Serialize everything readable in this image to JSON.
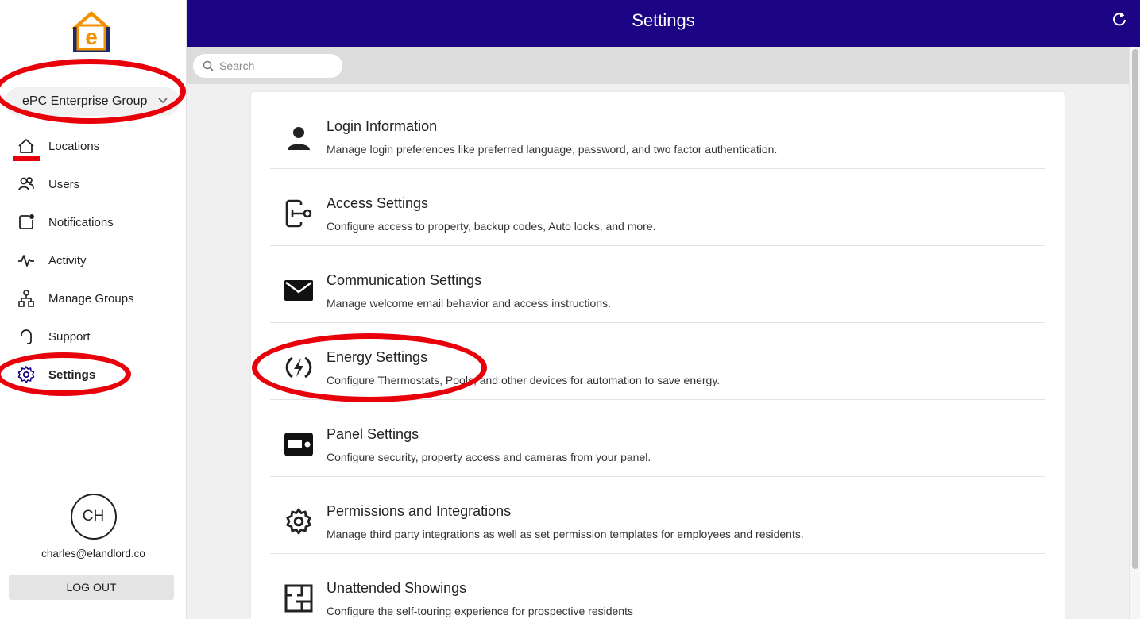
{
  "header": {
    "title": "Settings"
  },
  "org": {
    "name": "ePC Enterprise Group"
  },
  "logo": {
    "letter": "e"
  },
  "sidebar": {
    "items": [
      {
        "label": "Locations",
        "icon": "home-icon"
      },
      {
        "label": "Users",
        "icon": "users-icon"
      },
      {
        "label": "Notifications",
        "icon": "notification-icon"
      },
      {
        "label": "Activity",
        "icon": "activity-icon"
      },
      {
        "label": "Manage Groups",
        "icon": "groups-icon"
      },
      {
        "label": "Support",
        "icon": "support-icon"
      },
      {
        "label": "Settings",
        "icon": "gear-icon",
        "active": true
      }
    ]
  },
  "profile": {
    "initials": "CH",
    "email": "charles@elandlord.co",
    "logout_label": "LOG OUT"
  },
  "search": {
    "placeholder": "Search"
  },
  "settings": [
    {
      "title": "Login Information",
      "description": "Manage login preferences like preferred language, password, and two factor authentication.",
      "icon": "person-icon"
    },
    {
      "title": "Access Settings",
      "description": "Configure access to property, backup codes, Auto locks, and more.",
      "icon": "key-icon"
    },
    {
      "title": "Communication Settings",
      "description": "Manage welcome email behavior and access instructions.",
      "icon": "mail-icon"
    },
    {
      "title": "Energy Settings",
      "description": "Configure Thermostats, Pools, and other devices for automation to save energy.",
      "icon": "energy-icon"
    },
    {
      "title": "Panel Settings",
      "description": "Configure security, property access and cameras from your panel.",
      "icon": "panel-icon"
    },
    {
      "title": "Permissions and Integrations",
      "description": "Manage third party integrations as well as set permission templates for employees and residents.",
      "icon": "gear-icon"
    },
    {
      "title": "Unattended Showings",
      "description": "Configure the self-touring experience for prospective residents",
      "icon": "floorplan-icon"
    }
  ],
  "colors": {
    "header_bg": "#1b0585",
    "logo_orange": "#f39200",
    "logo_navy": "#1b2a6b",
    "annotation_red": "#e8000b"
  }
}
